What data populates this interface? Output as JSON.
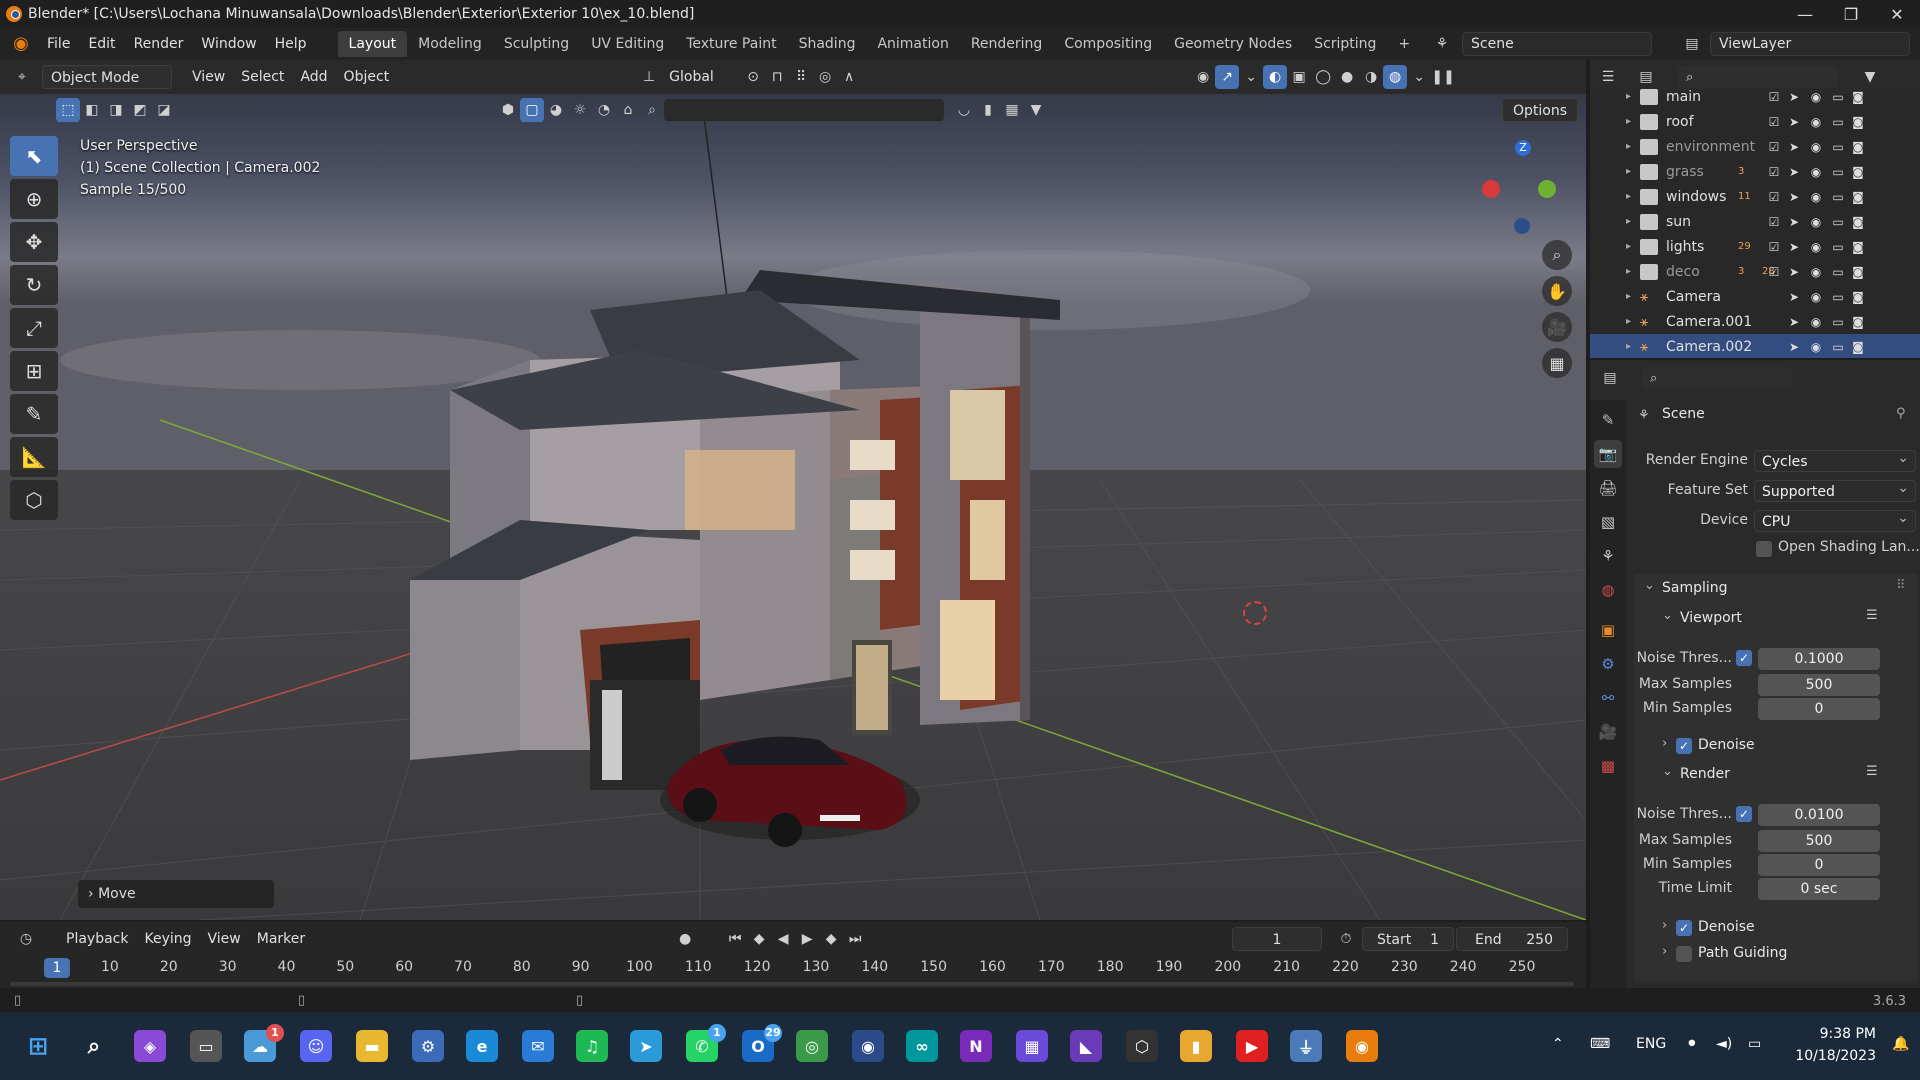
{
  "window": {
    "title": "Blender* [C:\\Users\\Lochana Minuwansala\\Downloads\\Blender\\Exterior\\Exterior 10\\ex_10.blend]",
    "minimize": "—",
    "maximize": "❐",
    "close": "✕"
  },
  "menu": {
    "items": [
      "File",
      "Edit",
      "Render",
      "Window",
      "Help"
    ],
    "workspaces": [
      "Layout",
      "Modeling",
      "Sculpting",
      "UV Editing",
      "Texture Paint",
      "Shading",
      "Animation",
      "Rendering",
      "Compositing",
      "Geometry Nodes",
      "Scripting"
    ],
    "active_workspace": "Layout",
    "add_tab": "+",
    "scene": "Scene",
    "view_layer": "ViewLayer"
  },
  "viewport": {
    "mode": "Object Mode",
    "menus": [
      "View",
      "Select",
      "Add",
      "Object"
    ],
    "transform_orientation": "Global",
    "options": "Options",
    "overlay_lines": [
      "User Perspective",
      "(1) Scene Collection | Camera.002",
      "Sample 15/500"
    ],
    "last_operation": "Move",
    "gizmo_z": "Z",
    "colors": {
      "sky_top": "#2b2f3c",
      "sky_mid": "#6a6f80",
      "ground": "#3b3b3d",
      "wall": "#8a8488",
      "brick": "#7a3a2a",
      "car": "#5a0e16",
      "accent": "#4772b3"
    }
  },
  "outliner": {
    "items": [
      {
        "name": "main",
        "type": "collection",
        "dim": false,
        "selected": false
      },
      {
        "name": "roof",
        "type": "collection",
        "dim": false,
        "selected": false
      },
      {
        "name": "environment",
        "type": "collection",
        "dim": true,
        "selected": false
      },
      {
        "name": "grass",
        "type": "collection",
        "dim": true,
        "selected": false,
        "count": "3"
      },
      {
        "name": "windows",
        "type": "collection",
        "dim": false,
        "selected": false,
        "count": "11"
      },
      {
        "name": "sun",
        "type": "collection",
        "dim": false,
        "selected": false
      },
      {
        "name": "lights",
        "type": "collection",
        "dim": false,
        "selected": false,
        "count": "29"
      },
      {
        "name": "deco",
        "type": "collection",
        "dim": true,
        "selected": false,
        "count": "3",
        "count2": "28"
      },
      {
        "name": "Camera",
        "type": "camera",
        "dim": false,
        "selected": false
      },
      {
        "name": "Camera.001",
        "type": "camera",
        "dim": false,
        "selected": false
      },
      {
        "name": "Camera.002",
        "type": "camera",
        "dim": false,
        "selected": true
      }
    ]
  },
  "properties": {
    "context": "Scene",
    "render_engine": {
      "label": "Render Engine",
      "value": "Cycles"
    },
    "feature_set": {
      "label": "Feature Set",
      "value": "Supported"
    },
    "device": {
      "label": "Device",
      "value": "CPU"
    },
    "open_shading": "Open Shading Lan...",
    "sampling": "Sampling",
    "viewport_section": "Viewport",
    "viewport": {
      "noise_label": "Noise Thres...",
      "noise_value": "0.1000",
      "max_label": "Max Samples",
      "max_value": "500",
      "min_label": "Min Samples",
      "min_value": "0",
      "denoise": "Denoise"
    },
    "render_section": "Render",
    "render": {
      "noise_label": "Noise Thres...",
      "noise_value": "0.0100",
      "max_label": "Max Samples",
      "max_value": "500",
      "min_label": "Min Samples",
      "min_value": "0",
      "time_label": "Time Limit",
      "time_value": "0 sec",
      "denoise": "Denoise",
      "path_guiding": "Path Guiding"
    }
  },
  "timeline": {
    "menus": [
      "Playback",
      "Keying",
      "View",
      "Marker"
    ],
    "current_frame": "1",
    "start_label": "Start",
    "start": "1",
    "end_label": "End",
    "end": "250",
    "ticks": [
      "1",
      "10",
      "20",
      "30",
      "40",
      "50",
      "60",
      "70",
      "80",
      "90",
      "100",
      "110",
      "120",
      "130",
      "140",
      "150",
      "160",
      "170",
      "180",
      "190",
      "200",
      "210",
      "220",
      "230",
      "240",
      "250"
    ]
  },
  "status": {
    "version": "3.6.3"
  },
  "taskbar": {
    "badges": {
      "weather": "1",
      "whatsapp": "1",
      "mail": "29"
    },
    "lang": "ENG",
    "time": "9:38 PM",
    "date": "10/18/2023"
  }
}
